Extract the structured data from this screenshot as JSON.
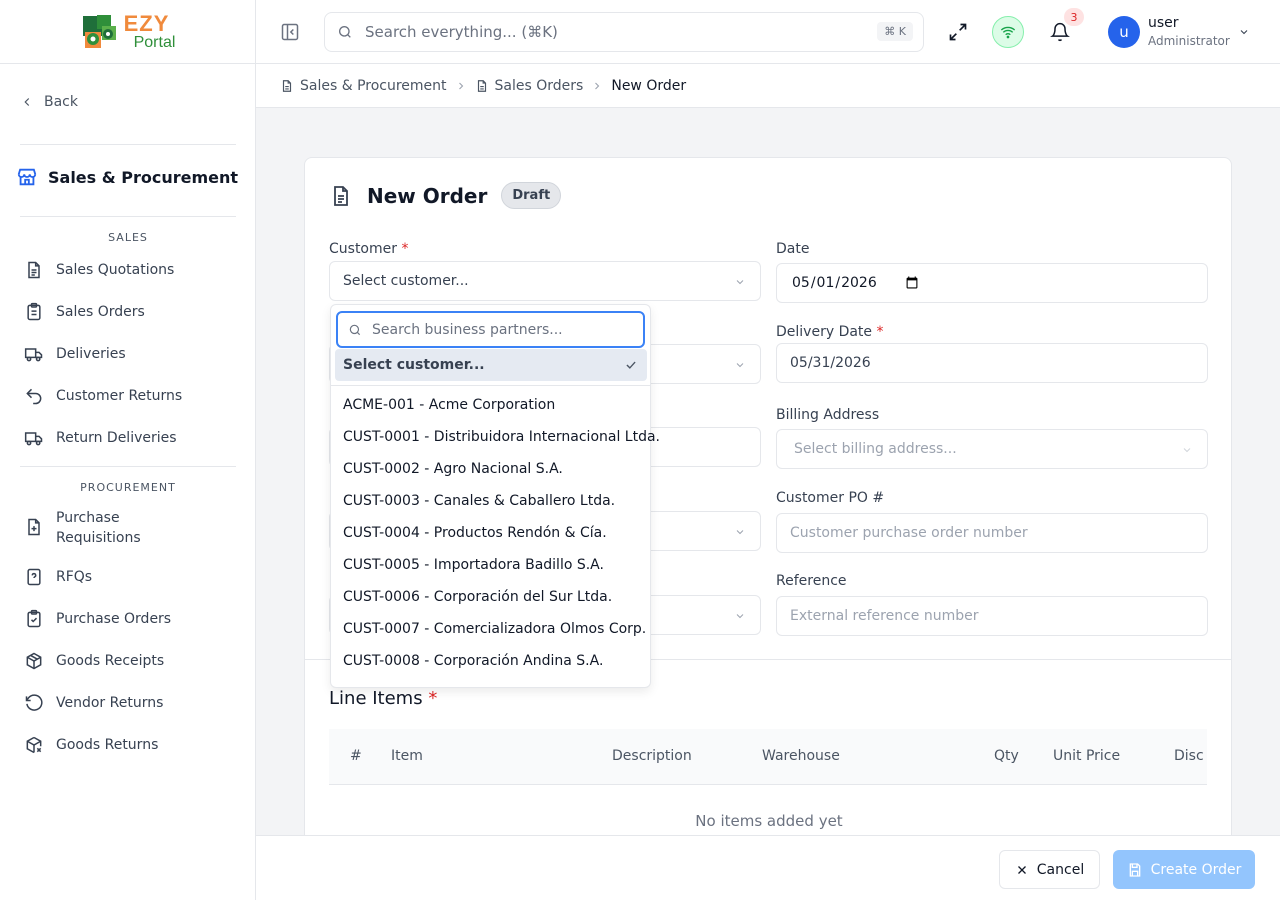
{
  "brand": {
    "line1": "EZY",
    "line2": "Portal"
  },
  "sidebar": {
    "back_label": "Back",
    "module_title": "Sales & Procurement",
    "sections": [
      {
        "title": "SALES",
        "items": [
          "Sales Quotations",
          "Sales Orders",
          "Deliveries",
          "Customer Returns",
          "Return Deliveries"
        ]
      },
      {
        "title": "PROCUREMENT",
        "items": [
          "Purchase Requisitions",
          "RFQs",
          "Purchase Orders",
          "Goods Receipts",
          "Vendor Returns",
          "Goods Returns"
        ]
      }
    ]
  },
  "topbar": {
    "search_placeholder": "Search everything... (⌘K)",
    "shortcut": "⌘ K",
    "notification_count": "3",
    "user": {
      "initial": "u",
      "name": "user",
      "role": "Administrator"
    }
  },
  "breadcrumb": [
    {
      "label": "Sales & Procurement"
    },
    {
      "label": "Sales Orders"
    },
    {
      "label": "New Order"
    }
  ],
  "form": {
    "title": "New Order",
    "status": "Draft",
    "required_mark": "*",
    "customer_label": "Customer",
    "customer_value": "Select customer...",
    "date_label": "Date",
    "date_value": "2026-05-01",
    "delivery_date_label": "Delivery Date",
    "delivery_date_value": "05/31/2026",
    "billing_label": "Billing Address",
    "billing_placeholder": "Select billing address...",
    "po_label": "Customer PO #",
    "po_placeholder": "Customer purchase order number",
    "reference_label": "Reference",
    "reference_placeholder": "External reference number"
  },
  "line_items": {
    "title": "Line Items",
    "columns": [
      "#",
      "Item",
      "Description",
      "Warehouse",
      "Qty",
      "Unit Price",
      "Disc %"
    ],
    "empty_text": "No items added yet"
  },
  "dropdown": {
    "search_placeholder": "Search business partners...",
    "selected": "Select customer...",
    "options": [
      "ACME-001 - Acme Corporation",
      "CUST-0001 - Distribuidora Internacional Ltda.",
      "CUST-0002 - Agro Nacional S.A.",
      "CUST-0003 - Canales & Caballero Ltda.",
      "CUST-0004 - Productos Rendón & Cía.",
      "CUST-0005 - Importadora Badillo S.A.",
      "CUST-0006 - Corporación del Sur Ltda.",
      "CUST-0007 - Comercializadora Olmos Corp.",
      "CUST-0008 - Corporación Andina S.A."
    ]
  },
  "footer": {
    "cancel_label": "Cancel",
    "create_label": "Create Order"
  }
}
